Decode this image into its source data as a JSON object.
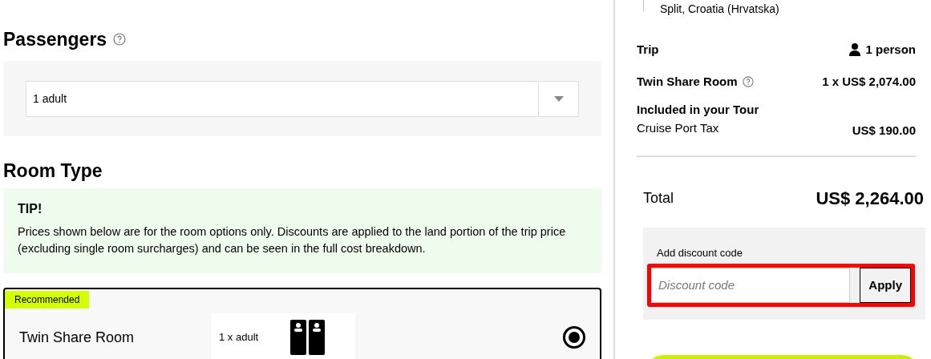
{
  "passengers": {
    "title": "Passengers",
    "select": {
      "value": "1 adult"
    }
  },
  "room_type": {
    "title": "Room Type",
    "tip": {
      "title": "TIP!",
      "text": "Prices shown below are for the room options only. Discounts are applied to the land portion of the trip price (excluding single room surcharges) and can be seen in the full cost breakdown."
    },
    "rooms": [
      {
        "badge": "Recommended",
        "name": "Twin Share Room",
        "occupancy": "1 x adult",
        "selected": true
      }
    ]
  },
  "summary": {
    "location": "Split, Croatia (Hrvatska)",
    "trip": {
      "label": "Trip",
      "value": "1 person"
    },
    "room": {
      "label": "Twin Share Room",
      "value": "1 x US$ 2,074.00"
    },
    "included": {
      "title": "Included in your Tour",
      "items": [
        {
          "label": "Cruise Port Tax",
          "value": "US$ 190.00"
        }
      ]
    },
    "total": {
      "label": "Total",
      "value": "US$ 2,264.00"
    },
    "discount": {
      "label": "Add discount code",
      "placeholder": "Discount code",
      "button": "Apply",
      "highlighted": true
    }
  }
}
